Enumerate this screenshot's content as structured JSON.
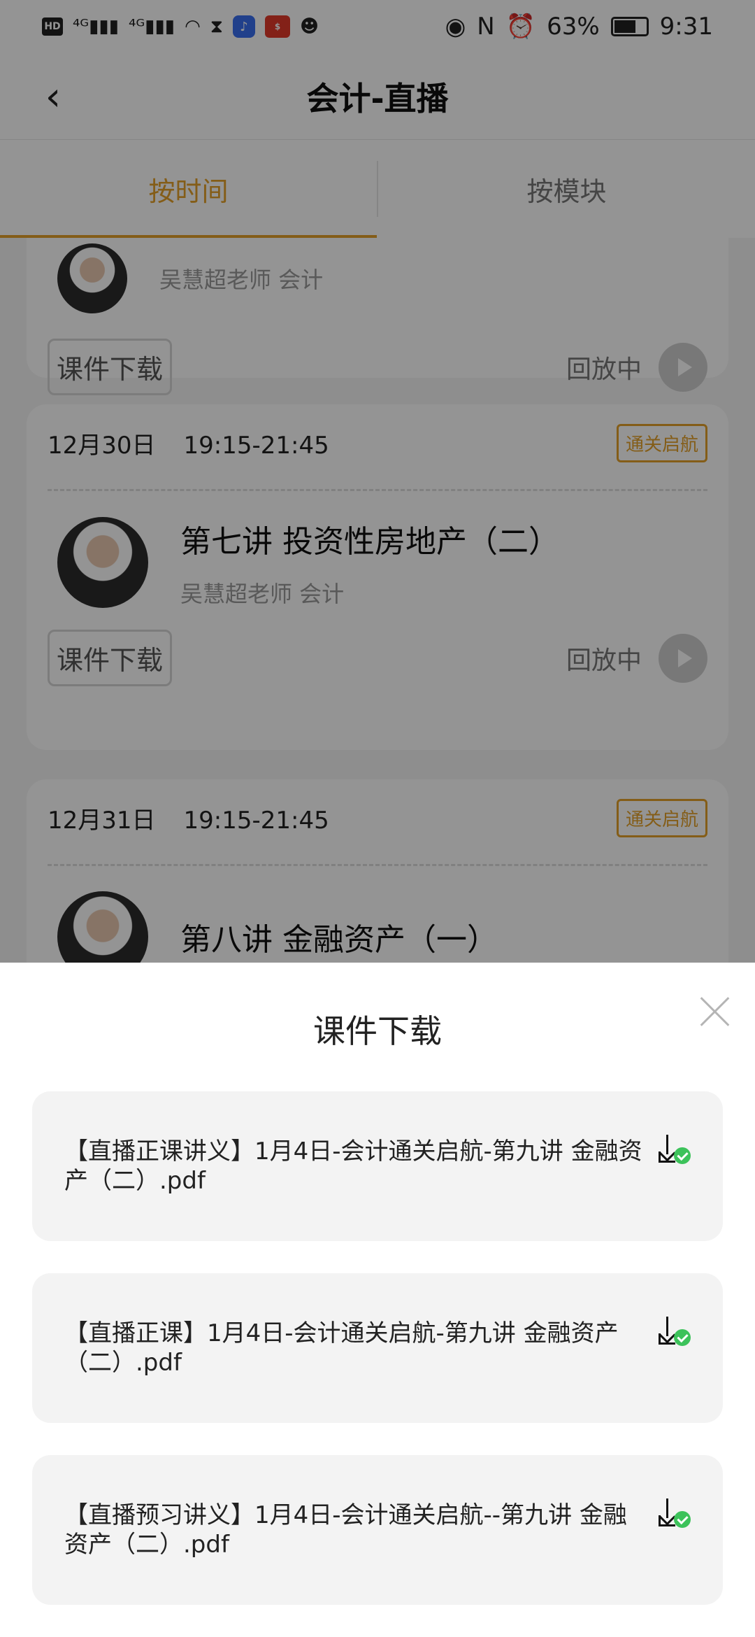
{
  "status_bar": {
    "left_icons": [
      "hd-icon",
      "signal-4g-icon",
      "signal-4g-icon",
      "wifi-icon",
      "hourglass-icon",
      "music-app-icon",
      "sale-app-icon",
      "qq-icon"
    ],
    "battery": "63%",
    "time": "9:31"
  },
  "header": {
    "title": "会计-直播"
  },
  "tabs": [
    {
      "label": "按时间",
      "active": true
    },
    {
      "label": "按模块",
      "active": false
    }
  ],
  "cards": [
    {
      "date": "",
      "time": "",
      "tag": "",
      "lesson_title": "",
      "teacher": "吴慧超老师 会计",
      "download_label": "课件下载",
      "status": "回放中"
    },
    {
      "date": "12月30日",
      "time": "19:15-21:45",
      "tag": "通关启航",
      "lesson_title": "第七讲 投资性房地产（二）",
      "teacher": "吴慧超老师 会计",
      "download_label": "课件下载",
      "status": "回放中"
    },
    {
      "date": "12月31日",
      "time": "19:15-21:45",
      "tag": "通关启航",
      "lesson_title": "第八讲 金融资产（一）",
      "teacher": "",
      "download_label": "",
      "status": ""
    }
  ],
  "sheet": {
    "title": "课件下载",
    "files": [
      {
        "name": "【直播正课讲义】1月4日-会计通关启航-第九讲 金融资产（二）.pdf",
        "downloaded": true
      },
      {
        "name": "【直播正课】1月4日-会计通关启航-第九讲 金融资产（二）.pdf",
        "downloaded": true
      },
      {
        "name": "【直播预习讲义】1月4日-会计通关启航--第九讲 金融资产（二）.pdf",
        "downloaded": true
      }
    ]
  },
  "colors": {
    "accent": "#e4a12a",
    "success": "#3cc25a",
    "overlay": "rgba(0,0,0,0.42)"
  }
}
